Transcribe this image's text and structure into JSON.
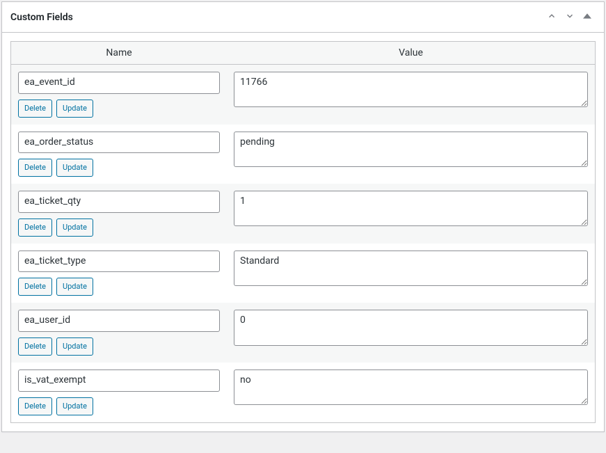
{
  "panel": {
    "title": "Custom Fields"
  },
  "columns": {
    "name": "Name",
    "value": "Value"
  },
  "buttons": {
    "delete": "Delete",
    "update": "Update"
  },
  "fields": [
    {
      "name": "ea_event_id",
      "value": "11766"
    },
    {
      "name": "ea_order_status",
      "value": "pending"
    },
    {
      "name": "ea_ticket_qty",
      "value": "1"
    },
    {
      "name": "ea_ticket_type",
      "value": "Standard"
    },
    {
      "name": "ea_user_id",
      "value": "0"
    },
    {
      "name": "is_vat_exempt",
      "value": "no"
    }
  ]
}
